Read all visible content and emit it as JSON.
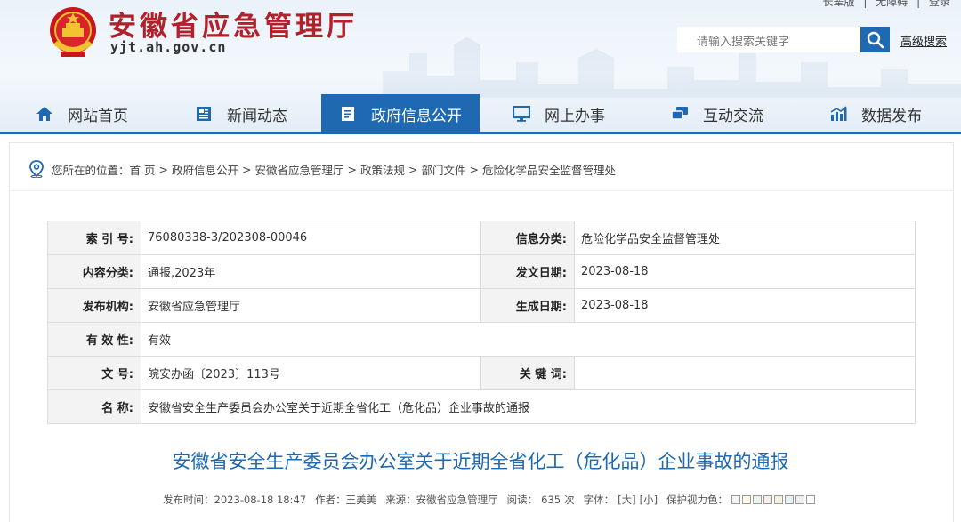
{
  "header": {
    "toplinks": [
      "长辈版",
      "无障碍",
      "登录"
    ],
    "site_title": "安徽省应急管理厅",
    "site_domain": "yjt.ah.gov.cn",
    "search_placeholder": "请输入搜索关键字",
    "advanced_search": "高级搜索"
  },
  "nav": {
    "items": [
      {
        "label": "网站首页",
        "icon": "home-icon"
      },
      {
        "label": "新闻动态",
        "icon": "newspaper-icon"
      },
      {
        "label": "政府信息公开",
        "icon": "document-icon",
        "active": true
      },
      {
        "label": "网上办事",
        "icon": "monitor-icon"
      },
      {
        "label": "互动交流",
        "icon": "chat-icon"
      },
      {
        "label": "数据发布",
        "icon": "bar-chart-icon"
      }
    ]
  },
  "breadcrumb": {
    "prefix": "您所在的位置：",
    "items": [
      "首 页",
      "政府信息公开",
      "安徽省应急管理厅",
      "政策法规",
      "部门文件",
      "危险化学品安全监督管理处"
    ]
  },
  "info": {
    "index_label": "索 引 号:",
    "index_value": "76080338-3/202308-00046",
    "category_label": "信息分类:",
    "category_value": "危险化学品安全监督管理处",
    "content_type_label": "内容分类:",
    "content_type_value": "通报,2023年",
    "issue_date_label": "发文日期:",
    "issue_date_value": "2023-08-18",
    "publisher_label": "发布机构:",
    "publisher_value": "安徽省应急管理厅",
    "created_date_label": "生成日期:",
    "created_date_value": "2023-08-18",
    "validity_label": "有 效 性:",
    "validity_value": "有效",
    "doc_no_label": "文 号:",
    "doc_no_value": "皖安办函〔2023〕113号",
    "keywords_label": "关 键 词:",
    "keywords_value": "",
    "name_label": "名 称:",
    "name_value": "安徽省安全生产委员会办公室关于近期全省化工（危化品）企业事故的通报"
  },
  "article": {
    "title": "安徽省安全生产委员会办公室关于近期全省化工（危化品）企业事故的通报",
    "publish_time": "发布时间：2023-08-18 18:47",
    "author": "作者：王美美",
    "source": "来源：安徽省应急管理厅",
    "reads_label": "阅读：",
    "reads_count": "635",
    "reads_unit": "次",
    "font_label": "字体：",
    "font_large": "[大]",
    "font_small": "[小]",
    "eye_care_label": "保护视力色：",
    "eye_care_colors": [
      "#f5f5f5",
      "#fff8e6",
      "#e9f6e9",
      "#fbecec",
      "#f3f3e0",
      "#e6f2f7",
      "#eeeeee",
      "#ffffff"
    ]
  },
  "colors": {
    "brand_blue": "#1e69b1",
    "title_red": "#b0212b"
  }
}
